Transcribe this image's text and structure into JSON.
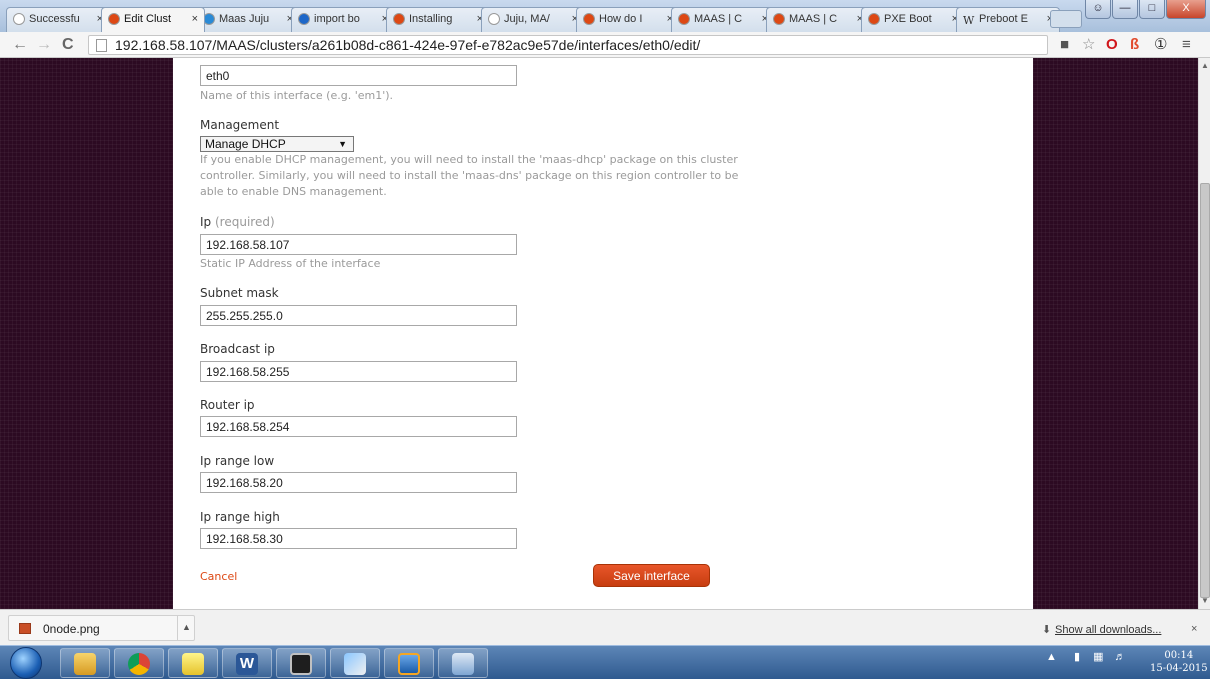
{
  "browser": {
    "tabs": [
      {
        "title": "Successfu",
        "favicon_color": "#ffffff"
      },
      {
        "title": "Edit Clust",
        "favicon_color": "#dd4814"
      },
      {
        "title": "Maas Juju",
        "favicon_color": "#2a8ad6"
      },
      {
        "title": "import bo",
        "favicon_color": "#1e67c8"
      },
      {
        "title": "Installing",
        "favicon_color": "#dd4814"
      },
      {
        "title": "Juju, MA/",
        "favicon_color": "#ffffff"
      },
      {
        "title": "How do I",
        "favicon_color": "#dd4814"
      },
      {
        "title": "MAAS | C",
        "favicon_color": "#dd4814"
      },
      {
        "title": "MAAS | C",
        "favicon_color": "#dd4814"
      },
      {
        "title": "PXE Boot",
        "favicon_color": "#dd4814"
      },
      {
        "title": "Preboot E",
        "favicon_color": "#ffffff"
      }
    ],
    "active_tab_index": 1,
    "close_glyph": "×",
    "wiki_glyph": "W",
    "address": "192.168.58.107/MAAS/clusters/a261b08d-c861-424e-97ef-e782ac9e57de/interfaces/eth0/edit/",
    "nav": {
      "back": "←",
      "forward": "→",
      "reload": "C"
    },
    "toolbar_icons": [
      "■",
      "☆",
      "O",
      "ß",
      "①",
      "≡"
    ]
  },
  "form": {
    "name_value": "eth0",
    "name_help": "Name of this interface (e.g. 'em1').",
    "management_label": "Management",
    "management_value": "Manage DHCP",
    "management_help": [
      "If you enable DHCP management, you will need to install the 'maas-dhcp' package on this cluster",
      "controller. Similarly, you will need to install the 'maas-dns' package on this region controller to be",
      "able to enable DNS management."
    ],
    "ip_label": "Ip",
    "ip_required": "(required)",
    "ip_value": "192.168.58.107",
    "ip_help": "Static IP Address of the interface",
    "subnet_label": "Subnet mask",
    "subnet_value": "255.255.255.0",
    "broadcast_label": "Broadcast ip",
    "broadcast_value": "192.168.58.255",
    "router_label": "Router ip",
    "router_value": "192.168.58.254",
    "range_low_label": "Ip range low",
    "range_low_value": "192.168.58.20",
    "range_high_label": "Ip range high",
    "range_high_value": "192.168.58.30",
    "cancel_label": "Cancel",
    "save_label": "Save interface"
  },
  "downloads": {
    "file_name": "0node.png",
    "show_all": "Show all downloads...",
    "close": "×"
  },
  "taskbar": {
    "time": "00:14",
    "date": "15-04-2015",
    "apps": [
      "explorer",
      "chrome",
      "sticky-notes",
      "word",
      "terminal",
      "paint",
      "virtualbox",
      "remote"
    ]
  },
  "colors": {
    "accent": "#dd4814",
    "sidebar_bg": "#2c0a22"
  }
}
